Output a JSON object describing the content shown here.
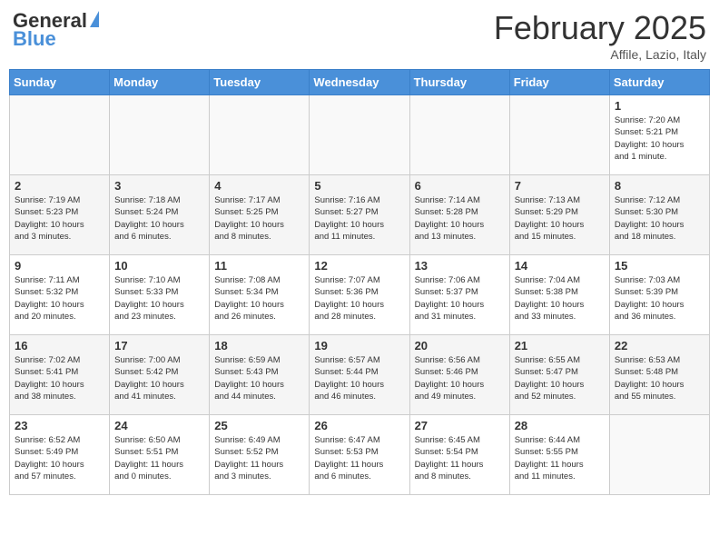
{
  "header": {
    "logo_general": "General",
    "logo_blue": "Blue",
    "month": "February 2025",
    "location": "Affile, Lazio, Italy"
  },
  "weekdays": [
    "Sunday",
    "Monday",
    "Tuesday",
    "Wednesday",
    "Thursday",
    "Friday",
    "Saturday"
  ],
  "weeks": [
    [
      {
        "day": "",
        "info": ""
      },
      {
        "day": "",
        "info": ""
      },
      {
        "day": "",
        "info": ""
      },
      {
        "day": "",
        "info": ""
      },
      {
        "day": "",
        "info": ""
      },
      {
        "day": "",
        "info": ""
      },
      {
        "day": "1",
        "info": "Sunrise: 7:20 AM\nSunset: 5:21 PM\nDaylight: 10 hours\nand 1 minute."
      }
    ],
    [
      {
        "day": "2",
        "info": "Sunrise: 7:19 AM\nSunset: 5:23 PM\nDaylight: 10 hours\nand 3 minutes."
      },
      {
        "day": "3",
        "info": "Sunrise: 7:18 AM\nSunset: 5:24 PM\nDaylight: 10 hours\nand 6 minutes."
      },
      {
        "day": "4",
        "info": "Sunrise: 7:17 AM\nSunset: 5:25 PM\nDaylight: 10 hours\nand 8 minutes."
      },
      {
        "day": "5",
        "info": "Sunrise: 7:16 AM\nSunset: 5:27 PM\nDaylight: 10 hours\nand 11 minutes."
      },
      {
        "day": "6",
        "info": "Sunrise: 7:14 AM\nSunset: 5:28 PM\nDaylight: 10 hours\nand 13 minutes."
      },
      {
        "day": "7",
        "info": "Sunrise: 7:13 AM\nSunset: 5:29 PM\nDaylight: 10 hours\nand 15 minutes."
      },
      {
        "day": "8",
        "info": "Sunrise: 7:12 AM\nSunset: 5:30 PM\nDaylight: 10 hours\nand 18 minutes."
      }
    ],
    [
      {
        "day": "9",
        "info": "Sunrise: 7:11 AM\nSunset: 5:32 PM\nDaylight: 10 hours\nand 20 minutes."
      },
      {
        "day": "10",
        "info": "Sunrise: 7:10 AM\nSunset: 5:33 PM\nDaylight: 10 hours\nand 23 minutes."
      },
      {
        "day": "11",
        "info": "Sunrise: 7:08 AM\nSunset: 5:34 PM\nDaylight: 10 hours\nand 26 minutes."
      },
      {
        "day": "12",
        "info": "Sunrise: 7:07 AM\nSunset: 5:36 PM\nDaylight: 10 hours\nand 28 minutes."
      },
      {
        "day": "13",
        "info": "Sunrise: 7:06 AM\nSunset: 5:37 PM\nDaylight: 10 hours\nand 31 minutes."
      },
      {
        "day": "14",
        "info": "Sunrise: 7:04 AM\nSunset: 5:38 PM\nDaylight: 10 hours\nand 33 minutes."
      },
      {
        "day": "15",
        "info": "Sunrise: 7:03 AM\nSunset: 5:39 PM\nDaylight: 10 hours\nand 36 minutes."
      }
    ],
    [
      {
        "day": "16",
        "info": "Sunrise: 7:02 AM\nSunset: 5:41 PM\nDaylight: 10 hours\nand 38 minutes."
      },
      {
        "day": "17",
        "info": "Sunrise: 7:00 AM\nSunset: 5:42 PM\nDaylight: 10 hours\nand 41 minutes."
      },
      {
        "day": "18",
        "info": "Sunrise: 6:59 AM\nSunset: 5:43 PM\nDaylight: 10 hours\nand 44 minutes."
      },
      {
        "day": "19",
        "info": "Sunrise: 6:57 AM\nSunset: 5:44 PM\nDaylight: 10 hours\nand 46 minutes."
      },
      {
        "day": "20",
        "info": "Sunrise: 6:56 AM\nSunset: 5:46 PM\nDaylight: 10 hours\nand 49 minutes."
      },
      {
        "day": "21",
        "info": "Sunrise: 6:55 AM\nSunset: 5:47 PM\nDaylight: 10 hours\nand 52 minutes."
      },
      {
        "day": "22",
        "info": "Sunrise: 6:53 AM\nSunset: 5:48 PM\nDaylight: 10 hours\nand 55 minutes."
      }
    ],
    [
      {
        "day": "23",
        "info": "Sunrise: 6:52 AM\nSunset: 5:49 PM\nDaylight: 10 hours\nand 57 minutes."
      },
      {
        "day": "24",
        "info": "Sunrise: 6:50 AM\nSunset: 5:51 PM\nDaylight: 11 hours\nand 0 minutes."
      },
      {
        "day": "25",
        "info": "Sunrise: 6:49 AM\nSunset: 5:52 PM\nDaylight: 11 hours\nand 3 minutes."
      },
      {
        "day": "26",
        "info": "Sunrise: 6:47 AM\nSunset: 5:53 PM\nDaylight: 11 hours\nand 6 minutes."
      },
      {
        "day": "27",
        "info": "Sunrise: 6:45 AM\nSunset: 5:54 PM\nDaylight: 11 hours\nand 8 minutes."
      },
      {
        "day": "28",
        "info": "Sunrise: 6:44 AM\nSunset: 5:55 PM\nDaylight: 11 hours\nand 11 minutes."
      },
      {
        "day": "",
        "info": ""
      }
    ]
  ]
}
